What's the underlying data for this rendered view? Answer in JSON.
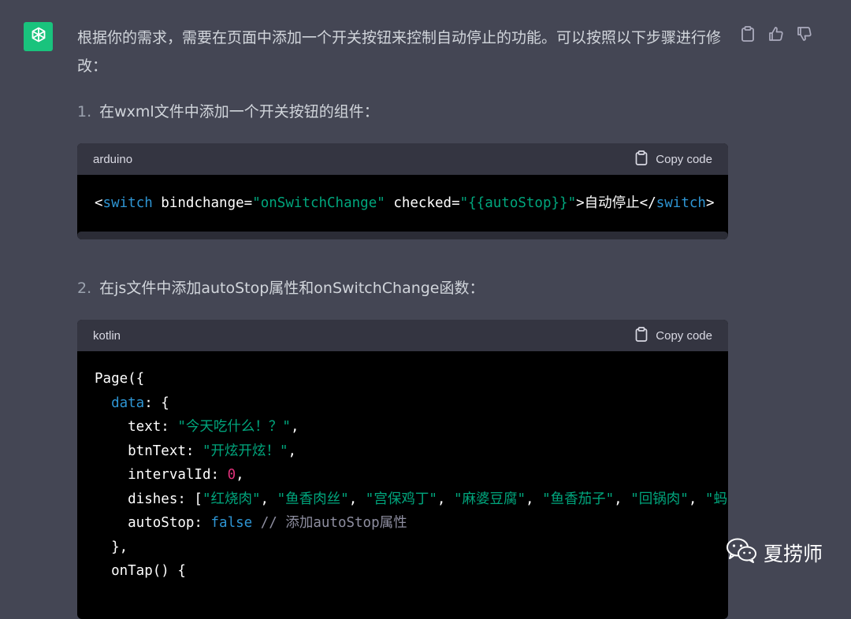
{
  "message": {
    "intro": "根据你的需求，需要在页面中添加一个开关按钮来控制自动停止的功能。可以按照以下步骤进行修改：",
    "actions": [
      "clipboard-icon",
      "thumbs-up-icon",
      "thumbs-down-icon"
    ],
    "steps": [
      {
        "num": "1.",
        "text": "在wxml文件中添加一个开关按钮的组件："
      },
      {
        "num": "2.",
        "text": "在js文件中添加autoStop属性和onSwitchChange函数："
      }
    ]
  },
  "code_blocks": [
    {
      "language": "arduino",
      "copy_label": "Copy code",
      "lines": [
        [
          {
            "t": "<",
            "c": "plain"
          },
          {
            "t": "switch",
            "c": "kw"
          },
          {
            "t": " bindchange=",
            "c": "plain"
          },
          {
            "t": "\"onSwitchChange\"",
            "c": "str"
          },
          {
            "t": " checked=",
            "c": "plain"
          },
          {
            "t": "\"{{autoStop}}\"",
            "c": "str"
          },
          {
            "t": ">自动停止</",
            "c": "plain"
          },
          {
            "t": "switch",
            "c": "kw"
          },
          {
            "t": ">",
            "c": "plain"
          }
        ]
      ]
    },
    {
      "language": "kotlin",
      "copy_label": "Copy code",
      "lines": [
        [
          {
            "t": "Page({",
            "c": "plain"
          }
        ],
        [
          {
            "t": "  ",
            "c": "plain"
          },
          {
            "t": "data",
            "c": "kw"
          },
          {
            "t": ": {",
            "c": "plain"
          }
        ],
        [
          {
            "t": "    text: ",
            "c": "plain"
          },
          {
            "t": "\"今天吃什么！？\"",
            "c": "str"
          },
          {
            "t": ",",
            "c": "plain"
          }
        ],
        [
          {
            "t": "    btnText: ",
            "c": "plain"
          },
          {
            "t": "\"开炫开炫！\"",
            "c": "str"
          },
          {
            "t": ",",
            "c": "plain"
          }
        ],
        [
          {
            "t": "    intervalId: ",
            "c": "plain"
          },
          {
            "t": "0",
            "c": "num-lit"
          },
          {
            "t": ",",
            "c": "plain"
          }
        ],
        [
          {
            "t": "    dishes: [",
            "c": "plain"
          },
          {
            "t": "\"红烧肉\"",
            "c": "str"
          },
          {
            "t": ", ",
            "c": "plain"
          },
          {
            "t": "\"鱼香肉丝\"",
            "c": "str"
          },
          {
            "t": ", ",
            "c": "plain"
          },
          {
            "t": "\"宫保鸡丁\"",
            "c": "str"
          },
          {
            "t": ", ",
            "c": "plain"
          },
          {
            "t": "\"麻婆豆腐\"",
            "c": "str"
          },
          {
            "t": ", ",
            "c": "plain"
          },
          {
            "t": "\"鱼香茄子\"",
            "c": "str"
          },
          {
            "t": ", ",
            "c": "plain"
          },
          {
            "t": "\"回锅肉\"",
            "c": "str"
          },
          {
            "t": ", ",
            "c": "plain"
          },
          {
            "t": "\"蚂",
            "c": "str"
          }
        ],
        [
          {
            "t": "    autoStop: ",
            "c": "plain"
          },
          {
            "t": "false",
            "c": "kw"
          },
          {
            "t": " // 添加autoStop属性",
            "c": "cmt"
          }
        ],
        [
          {
            "t": "  },",
            "c": "plain"
          }
        ],
        [
          {
            "t": "  onTap() {",
            "c": "plain"
          }
        ]
      ]
    }
  ],
  "watermark": {
    "text": "夏捞师",
    "icon": "wechat-icon"
  },
  "colors": {
    "background": "#444654",
    "avatar": "#19c37d",
    "code_header": "#343541",
    "code_bg": "#000000",
    "keyword": "#2e95d3",
    "string": "#00a67d",
    "number": "#df3079",
    "comment": "#8e8ea0"
  }
}
